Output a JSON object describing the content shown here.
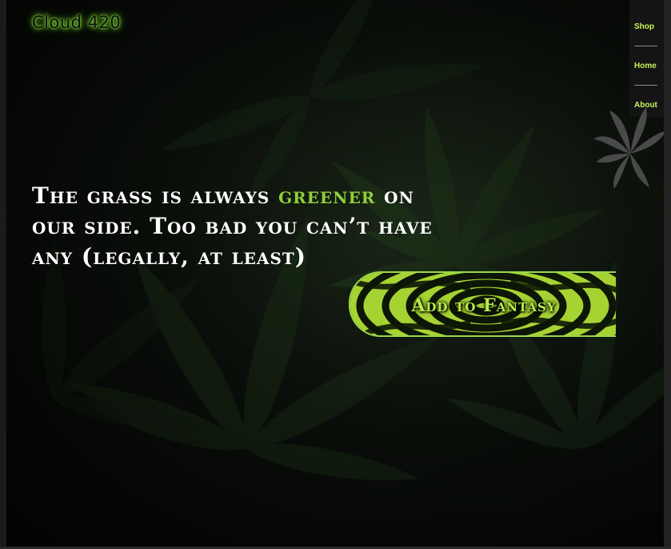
{
  "brand": {
    "name": "Cloud 420"
  },
  "nav": {
    "items": [
      {
        "label": "Shop"
      },
      {
        "label": "Home"
      },
      {
        "label": "About"
      }
    ]
  },
  "hero": {
    "headline_part1": "The grass is always ",
    "headline_accent": "greener",
    "headline_part2": " on our side. Too bad you can’t have any (legally, at least)",
    "cta_label": "Add to Fantasy"
  },
  "colors": {
    "accent": "#8fcf3a",
    "nav_text": "#c7f35a",
    "background": "#0b0f0a"
  },
  "icons": {
    "decoration": "cannabis-leaf-icon"
  }
}
